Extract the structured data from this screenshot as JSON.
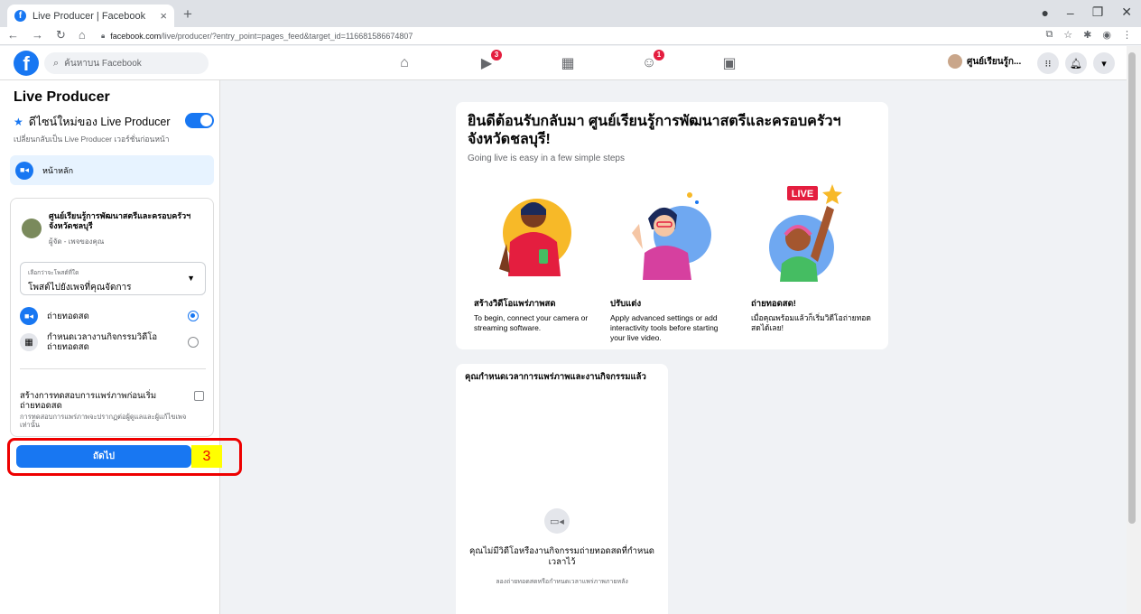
{
  "browser": {
    "tab_title": "Live Producer | Facebook",
    "tab_close": "×",
    "new_tab": "+",
    "url_host": "facebook.com",
    "url_path": "/live/producer/?entry_point=pages_feed&target_id=116681586674807"
  },
  "fb_header": {
    "search_placeholder": "ค้นหาบน Facebook",
    "nav_badges": {
      "watch": "3",
      "groups": "1"
    },
    "page_name": "ศูนย์เรียนรู้ก..."
  },
  "sidebar": {
    "title": "Live Producer",
    "new_design_label": "ดีไซน์ใหม่ของ Live Producer",
    "new_design_on": true,
    "revert_text": "เปลี่ยนกลับเป็น Live Producer เวอร์ชั่นก่อนหน้า",
    "home_label": "หน้าหลัก",
    "page_card": {
      "name": "ศูนย์เรียนรู้การพัฒนาสตรีและครอบครัวฯ จังหวัดชลบุรี",
      "role": "ผู้จัด - เพจของคุณ"
    },
    "post_select": {
      "label": "เลือกว่าจะโพสต์ที่ใด",
      "value": "โพสต์ไปยังเพจที่คุณจัดการ"
    },
    "options": [
      {
        "label": "ถ่ายทอดสด",
        "selected": true
      },
      {
        "label": "กำหนดเวลางานกิจกรรมวิดีโอถ่ายทอดสด",
        "selected": false
      }
    ],
    "test_broadcast": {
      "label": "สร้างการทดสอบการแพร่ภาพก่อนเริ่มถ่ายทอดสด",
      "sub": "การทดสอบการแพร่ภาพจะปรากฏต่อผู้ดูแลและผู้แก้ไขเพจเท่านั้น",
      "checked": false
    },
    "next_button": "ถัดไป",
    "annotation_marker": "3"
  },
  "welcome": {
    "title": "ยินดีต้อนรับกลับมา ศูนย์เรียนรู้การพัฒนาสตรีและครอบครัวฯ จังหวัดชลบุรี!",
    "subtitle": "Going live is easy in a few simple steps",
    "live_sign": "LIVE",
    "steps": [
      {
        "title": "สร้างวิดีโอแพร่ภาพสด",
        "desc": "To begin, connect your camera or streaming software."
      },
      {
        "title": "ปรับแต่ง",
        "desc": "Apply advanced settings or add interactivity tools before starting your live video."
      },
      {
        "title": "ถ่ายทอดสด!",
        "desc": "เมื่อคุณพร้อมแล้วก็เริ่มวิดีโอถ่ายทอดสดได้เลย!"
      }
    ]
  },
  "scheduled": {
    "title": "คุณกำหนดเวลาการแพร่ภาพและงานกิจกรรมแล้ว",
    "empty_title": "คุณไม่มีวิดีโอหรืองานกิจกรรมถ่ายทอดสดที่กำหนดเวลาไว้",
    "empty_sub": "ลองถ่ายทอดสดหรือกำหนดเวลาแพร่ภาพภายหลัง"
  },
  "colors": {
    "accent": "#1877f2",
    "highlight": "#ee0000",
    "marker_bg": "#ffff00"
  }
}
